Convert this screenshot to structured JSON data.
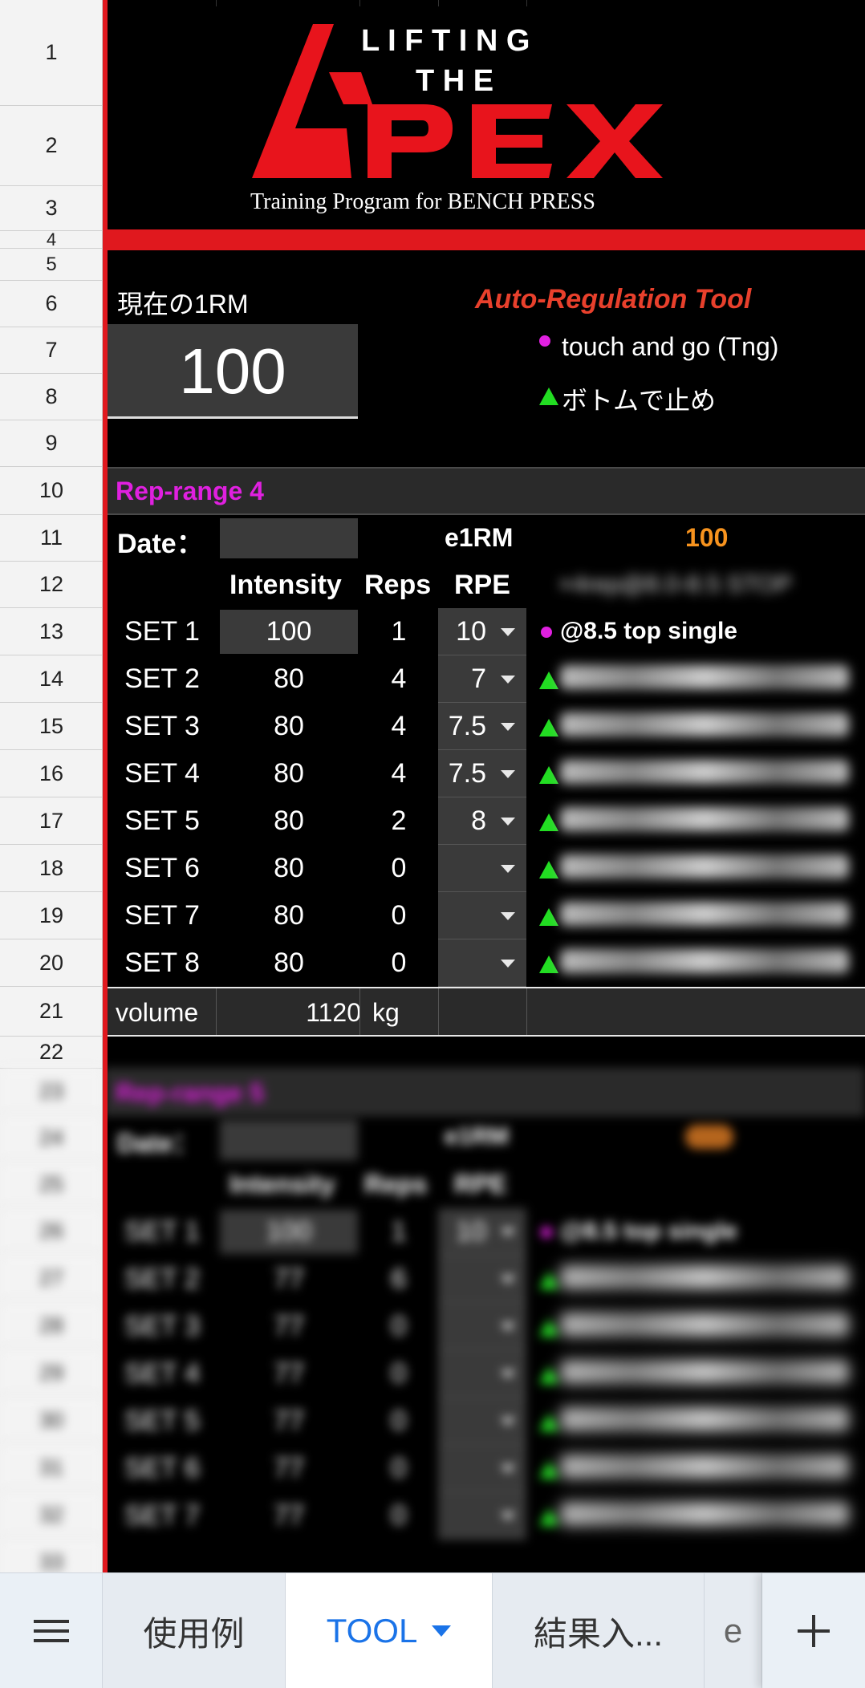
{
  "row_numbers": [
    "1",
    "2",
    "3",
    "4",
    "5",
    "6",
    "7",
    "8",
    "9",
    "10",
    "11",
    "12",
    "13",
    "14",
    "15",
    "16",
    "17",
    "18",
    "19",
    "20",
    "21",
    "22",
    "23",
    "24",
    "25",
    "26",
    "27",
    "28",
    "29",
    "30",
    "31",
    "32",
    "33"
  ],
  "logo": {
    "lifting": "L I F T I N G",
    "the": "T H E",
    "apex": "APEX",
    "tagline": "Training Program for BENCH  PRESS",
    "brand_red": "#e8141c"
  },
  "current_1rm": {
    "label": "現在の1RM",
    "value": "100"
  },
  "auto_reg": {
    "title": "Auto-Regulation Tool",
    "legend_tng": "touch and go (Tng)",
    "legend_pause": "ボトムで止め",
    "title_color": "#e8402c",
    "tng_color": "#e020e0",
    "pause_color": "#22dd22"
  },
  "block1": {
    "title": "Rep-range 4",
    "title_color": "#e020e0",
    "date_label": "Date：",
    "date_value": "",
    "e1rm_label": "e1RM",
    "e1rm_value": "100",
    "e1rm_color": "#f7931e",
    "headers": {
      "intensity": "Intensity",
      "reps": "Reps",
      "rpe": "RPE"
    },
    "sets": [
      {
        "name": "SET 1",
        "intensity": "100",
        "reps": "1",
        "rpe": "10",
        "note": "@8.5 top single"
      },
      {
        "name": "SET 2",
        "intensity": "80",
        "reps": "4",
        "rpe": "7",
        "note": ""
      },
      {
        "name": "SET 3",
        "intensity": "80",
        "reps": "4",
        "rpe": "7.5",
        "note": ""
      },
      {
        "name": "SET 4",
        "intensity": "80",
        "reps": "4",
        "rpe": "7.5",
        "note": ""
      },
      {
        "name": "SET 5",
        "intensity": "80",
        "reps": "2",
        "rpe": "8",
        "note": ""
      },
      {
        "name": "SET 6",
        "intensity": "80",
        "reps": "0",
        "rpe": "",
        "note": ""
      },
      {
        "name": "SET 7",
        "intensity": "80",
        "reps": "0",
        "rpe": "",
        "note": ""
      },
      {
        "name": "SET 8",
        "intensity": "80",
        "reps": "0",
        "rpe": "",
        "note": ""
      }
    ],
    "volume_label": "volume",
    "volume_value": "1120",
    "volume_unit": "kg"
  },
  "block2": {
    "title": "Rep-range 5",
    "date_label": "Date：",
    "e1rm_label": "e1RM",
    "headers": {
      "intensity": "Intensity",
      "reps": "Reps",
      "rpe": "RPE"
    },
    "sets": [
      {
        "name": "SET 1",
        "intensity": "100",
        "reps": "1",
        "rpe": "10",
        "note": "@8.5 top single"
      },
      {
        "name": "SET 2",
        "intensity": "77",
        "reps": "6",
        "rpe": "",
        "note": ""
      },
      {
        "name": "SET 3",
        "intensity": "77",
        "reps": "0",
        "rpe": "",
        "note": ""
      },
      {
        "name": "SET 4",
        "intensity": "77",
        "reps": "0",
        "rpe": "",
        "note": ""
      },
      {
        "name": "SET 5",
        "intensity": "77",
        "reps": "0",
        "rpe": "",
        "note": ""
      },
      {
        "name": "SET 6",
        "intensity": "77",
        "reps": "0",
        "rpe": "",
        "note": ""
      },
      {
        "name": "SET 7",
        "intensity": "77",
        "reps": "0",
        "rpe": "",
        "note": ""
      }
    ]
  },
  "tabs": {
    "menu_icon": "hamburger-icon",
    "items": [
      {
        "label": "使用例",
        "active": false
      },
      {
        "label": "TOOL",
        "active": true
      },
      {
        "label": "結果入...",
        "active": false
      },
      {
        "label": "e",
        "active": false
      }
    ],
    "add_icon": "plus-icon",
    "active_color": "#1a73e8"
  }
}
